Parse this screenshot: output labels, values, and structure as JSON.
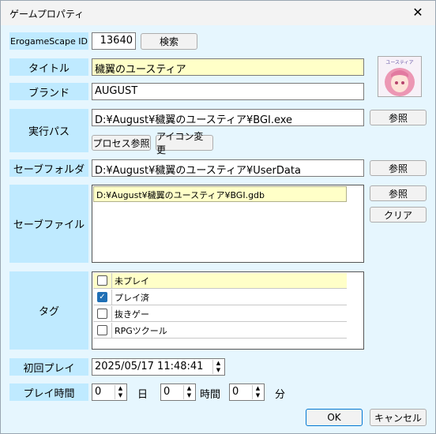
{
  "window": {
    "title": "ゲームプロパティ",
    "close_glyph": "✕"
  },
  "labels": {
    "erogamescape": "ErogameScape ID",
    "title": "タイトル",
    "brand": "ブランド",
    "exe": "実行パス",
    "save_folder": "セーブフォルダ",
    "save_file": "セーブファイル",
    "tag": "タグ",
    "first_play": "初回プレイ",
    "play_time": "プレイ時間"
  },
  "values": {
    "erogamescape_id": "13640",
    "title": "穢翼のユースティア",
    "brand": "AUGUST",
    "exe_path": "D:¥August¥穢翼のユースティア¥BGI.exe",
    "save_folder": "D:¥August¥穢翼のユースティア¥UserData",
    "save_file": "D:¥August¥穢翼のユースティア¥BGI.gdb",
    "first_play": "2025/05/17 11:48:41",
    "hours": "0",
    "minutes": "0",
    "seconds": "0"
  },
  "units": {
    "day": "日",
    "hour": "時間",
    "minute": "分"
  },
  "buttons": {
    "search": "検索",
    "browse": "参照",
    "process_browse": "プロセス参照",
    "icon_change": "アイコン変更",
    "clear": "クリア",
    "ok": "OK",
    "cancel": "キャンセル"
  },
  "tags": [
    {
      "label": "未プレイ",
      "checked": false
    },
    {
      "label": "プレイ済",
      "checked": true
    },
    {
      "label": "抜きゲー",
      "checked": false
    },
    {
      "label": "RPGツクール",
      "checked": false
    }
  ],
  "glyphs": {
    "check": "✓",
    "spin_up": "▲",
    "spin_down": "▼"
  },
  "colors": {
    "label_bg": "#bfeaff",
    "window_bg": "#e6f6fe",
    "highlight": "#ffffc8",
    "check": "#1f6fb5"
  }
}
